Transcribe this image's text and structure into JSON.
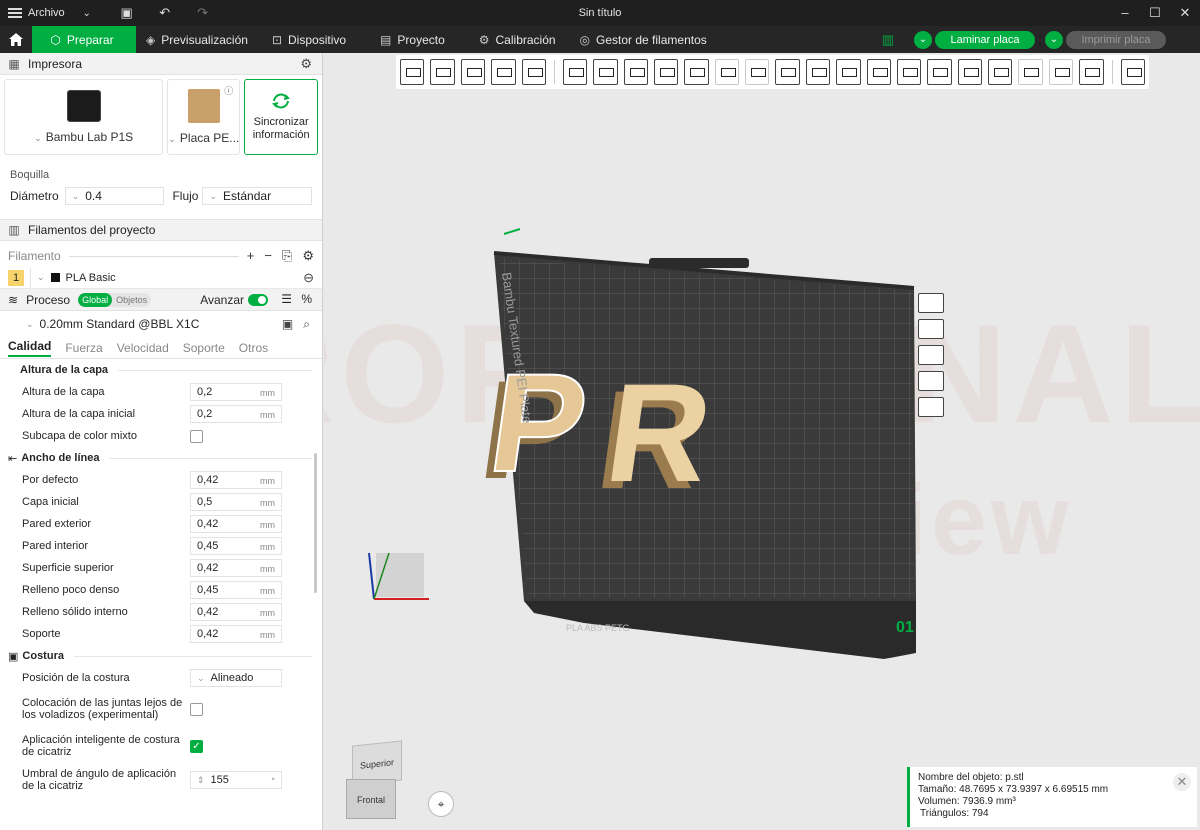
{
  "titlebar": {
    "menu_label": "Archivo",
    "title": "Sin título",
    "icons": [
      "save-icon",
      "undo-icon",
      "redo-icon"
    ]
  },
  "nav": {
    "tabs": [
      {
        "label": "Preparar",
        "icon": "cube-icon",
        "active": true
      },
      {
        "label": "Previsualización",
        "icon": "layers-icon",
        "active": false
      },
      {
        "label": "Dispositivo",
        "icon": "device-icon",
        "active": false
      },
      {
        "label": "Proyecto",
        "icon": "document-icon",
        "active": false
      },
      {
        "label": "Calibración",
        "icon": "calibration-icon",
        "active": false
      },
      {
        "label": "Gestor de filamentos",
        "icon": "filament-manager-icon",
        "active": false
      }
    ],
    "slice_label": "Laminar placa",
    "print_label": "Imprimir placa"
  },
  "printer": {
    "section_title": "Impresora",
    "printer_name": "Bambu Lab P1S",
    "plate_name": "Placa PE...",
    "sync_label": "Sincronizar información",
    "nozzle_title": "Boquilla",
    "diameter_label": "Diámetro",
    "diameter_value": "0.4",
    "flow_label": "Flujo",
    "flow_value": "Estándar"
  },
  "filaments": {
    "section_title": "Filamentos del proyecto",
    "filament_label": "Filamento",
    "items": [
      {
        "index": "1",
        "name": "PLA Basic",
        "color": "#f7d36b"
      }
    ]
  },
  "process": {
    "section_title": "Proceso",
    "scope_global": "Global",
    "scope_objects": "Objetos",
    "advanced_label": "Avanzar",
    "preset": "0.20mm Standard @BBL X1C",
    "tabs": [
      "Calidad",
      "Fuerza",
      "Velocidad",
      "Soporte",
      "Otros"
    ],
    "groups": [
      {
        "title": "Altura de la capa",
        "rows": [
          {
            "label": "Altura de la capa",
            "value": "0,2",
            "unit": "mm"
          },
          {
            "label": "Altura de la capa inicial",
            "value": "0,2",
            "unit": "mm"
          },
          {
            "label": "Subcapa de color mixto",
            "checkbox": false
          }
        ]
      },
      {
        "title": "Ancho de línea",
        "rows": [
          {
            "label": "Por defecto",
            "value": "0,42",
            "unit": "mm"
          },
          {
            "label": "Capa inicial",
            "value": "0,5",
            "unit": "mm"
          },
          {
            "label": "Pared exterior",
            "value": "0,42",
            "unit": "mm"
          },
          {
            "label": "Pared interior",
            "value": "0,45",
            "unit": "mm"
          },
          {
            "label": "Superficie superior",
            "value": "0,42",
            "unit": "mm"
          },
          {
            "label": "Relleno poco denso",
            "value": "0,45",
            "unit": "mm"
          },
          {
            "label": "Relleno sólido interno",
            "value": "0,42",
            "unit": "mm"
          },
          {
            "label": "Soporte",
            "value": "0,42",
            "unit": "mm"
          }
        ]
      },
      {
        "title": "Costura",
        "rows": [
          {
            "label": "Posición de la costura",
            "select": "Alineado"
          },
          {
            "label": "Colocación de las juntas lejos de los voladizos (experimental)",
            "checkbox": false
          },
          {
            "label": "Aplicación inteligente de costura de cicatriz",
            "checkbox": true
          },
          {
            "label": "Umbral de ángulo de aplicación de la cicatriz",
            "value": "155",
            "unit": "°"
          }
        ]
      }
    ]
  },
  "viewport": {
    "plate_label": "Bambu Textured PEI Plate",
    "plate_material": "PLA ABS PETG",
    "plate_number": "01",
    "watermark_1": "PROFESIONAL",
    "watermark_2": "Review",
    "view_top": "Superior",
    "view_front": "Frontal",
    "object_letters": "PR"
  },
  "object_info": {
    "name": "Nombre del objeto: p.stl",
    "size": "Tamaño: 48.7695 x 73.9397 x 6.69515 mm",
    "volume": "Volumen: 7936.9 mm³",
    "triangles": "Triángulos: 794"
  },
  "colors": {
    "accent": "#00ae42",
    "dark_bar": "#262626",
    "plate": "#3a3a3a"
  }
}
